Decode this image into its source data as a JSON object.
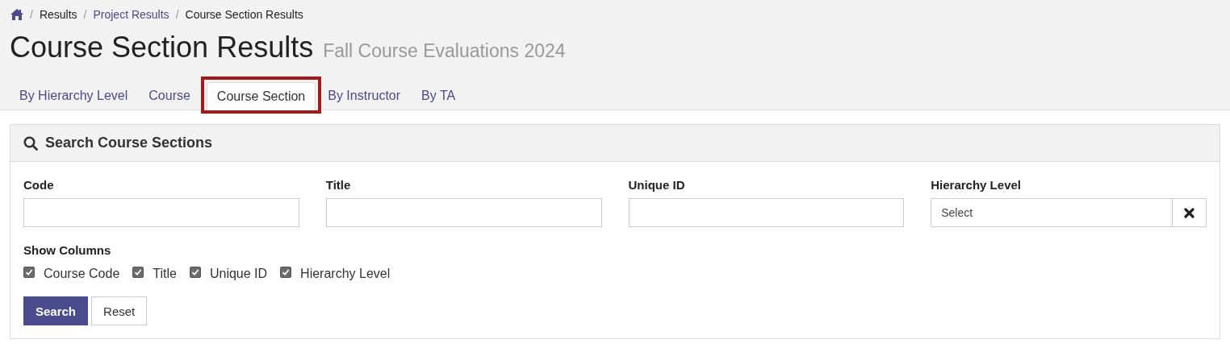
{
  "breadcrumb": [
    {
      "separator": "/",
      "label": "Results",
      "link": false
    },
    {
      "separator": "/",
      "label": "Project Results",
      "link": true
    },
    {
      "separator": "/",
      "label": "Course Section Results",
      "link": false
    }
  ],
  "heading": {
    "title": "Course Section Results",
    "subtitle": "Fall Course Evaluations 2024"
  },
  "tabs": [
    {
      "label": "By Hierarchy Level",
      "selected": false,
      "highlighted": false
    },
    {
      "label": "Course",
      "selected": false,
      "highlighted": false
    },
    {
      "label": "Course Section",
      "selected": true,
      "highlighted": true
    },
    {
      "label": "By Instructor",
      "selected": false,
      "highlighted": false
    },
    {
      "label": "By TA",
      "selected": false,
      "highlighted": false
    }
  ],
  "search_panel": {
    "title": "Search Course Sections",
    "fields": [
      {
        "kind": "text",
        "label": "Code"
      },
      {
        "kind": "text",
        "label": "Title"
      },
      {
        "kind": "text",
        "label": "Unique ID"
      },
      {
        "kind": "select",
        "label": "Hierarchy Level",
        "placeholder": "Select"
      }
    ],
    "show_columns": {
      "label": "Show Columns",
      "options": [
        {
          "label": "Course Code",
          "checked": true
        },
        {
          "label": "Title",
          "checked": true
        },
        {
          "label": "Unique ID",
          "checked": true
        },
        {
          "label": "Hierarchy Level",
          "checked": true
        }
      ]
    },
    "buttons": [
      {
        "label": "Search",
        "kind": "primary"
      },
      {
        "label": "Reset",
        "kind": "default"
      }
    ]
  }
}
